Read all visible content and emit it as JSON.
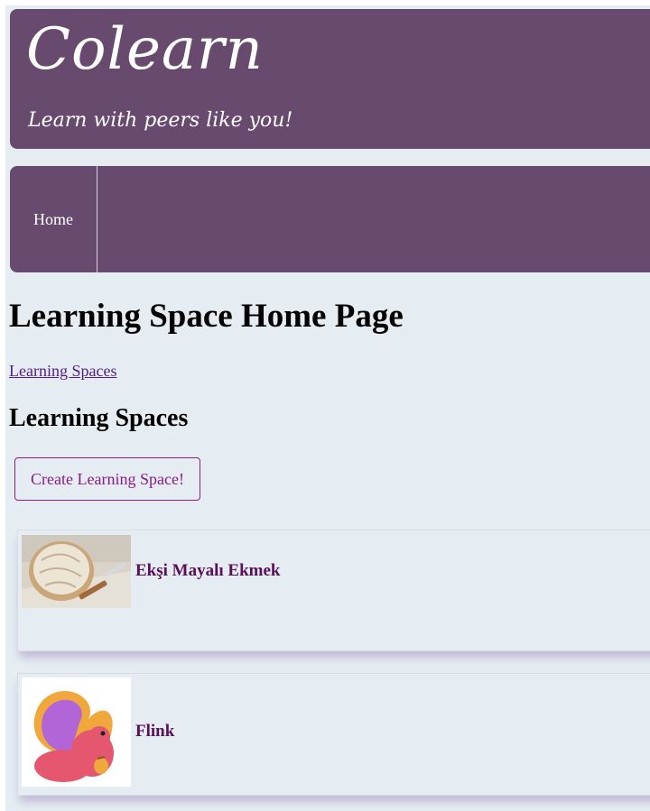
{
  "header": {
    "brand": "Colearn",
    "tagline": "Learn with peers like you!"
  },
  "nav": {
    "items": [
      {
        "label": "Home"
      }
    ]
  },
  "main": {
    "title": "Learning Space Home Page",
    "breadcrumb": "Learning Spaces",
    "section_title": "Learning Spaces",
    "create_button": "Create Learning Space!",
    "spaces": [
      {
        "name": "Ekşi Mayalı Ekmek",
        "icon": "bread-image"
      },
      {
        "name": "Flink",
        "icon": "flink-squirrel-logo"
      }
    ]
  },
  "colors": {
    "header_bg": "#694a6f",
    "page_bg": "#e5edf2",
    "accent": "#8a1a8e",
    "card_title": "#5a0f5a",
    "link": "#551a8b"
  }
}
